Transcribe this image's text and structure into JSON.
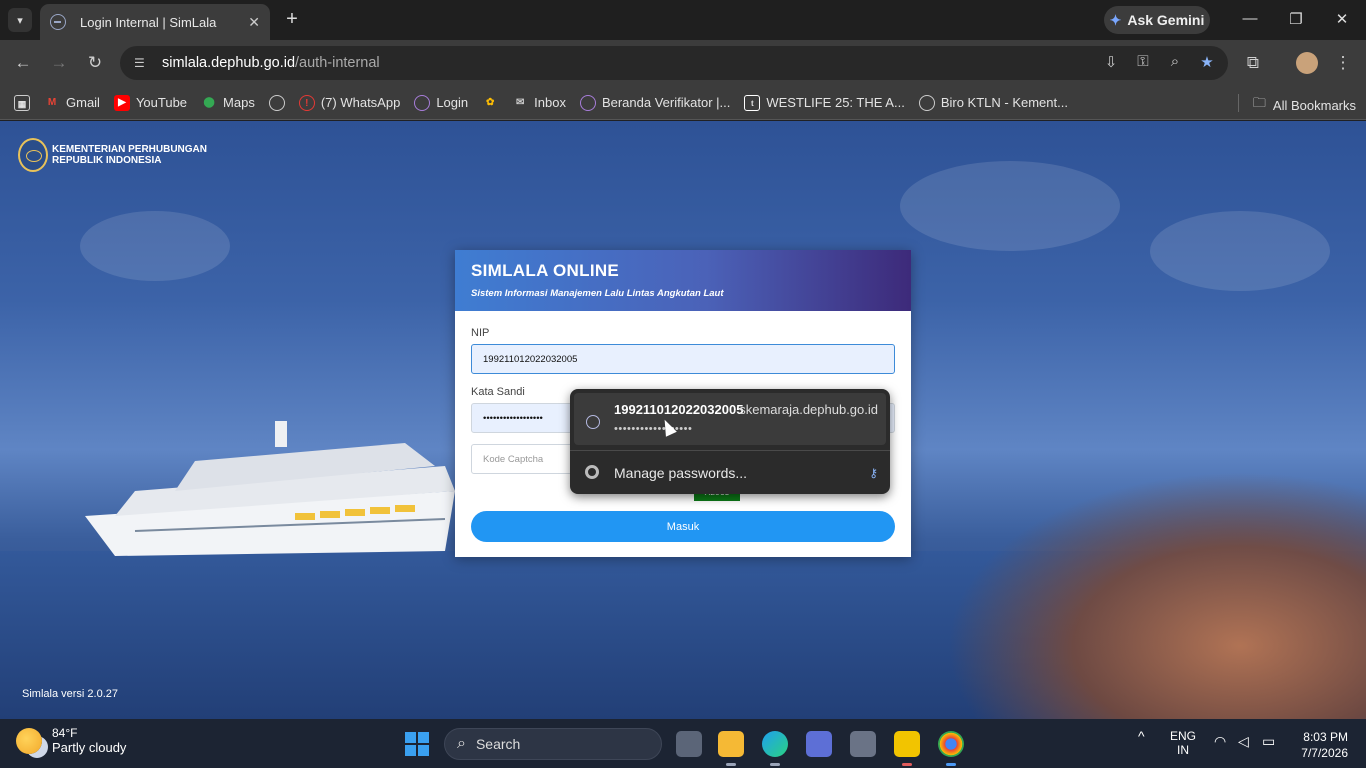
{
  "browser": {
    "tab_title": "Login Internal | SimLala",
    "ask_gemini": "Ask Gemini",
    "url_host": "simlala.dephub.go.id",
    "url_path": "/auth-internal",
    "bookmarks": [
      {
        "label": "Gmail",
        "icon": "gmail-icon",
        "color": "#ea4335"
      },
      {
        "label": "YouTube",
        "icon": "youtube-icon",
        "color": "#ff0000"
      },
      {
        "label": "Maps",
        "icon": "maps-icon",
        "color": "#34a853"
      },
      {
        "label": "",
        "icon": "globe-icon",
        "color": "#cccccc"
      },
      {
        "label": "(7) WhatsApp",
        "icon": "whatsapp-icon",
        "color": "#e53935"
      },
      {
        "label": "Login",
        "icon": "globe-icon",
        "color": "#a77dd9"
      },
      {
        "label": "",
        "icon": "photos-icon",
        "color": "#fbbc04"
      },
      {
        "label": "Inbox",
        "icon": "mail-icon",
        "color": "#cccccc"
      },
      {
        "label": "Beranda Verifikator |...",
        "icon": "globe-icon",
        "color": "#a77dd9"
      },
      {
        "label": "WESTLIFE 25: THE A...",
        "icon": "ticket-icon",
        "color": "#ffffff"
      },
      {
        "label": "Biro KTLN - Kement...",
        "icon": "globe-icon",
        "color": "#cccccc"
      }
    ],
    "all_bookmarks": "All Bookmarks"
  },
  "page": {
    "logo_line1": "KEMENTERIAN PERHUBUNGAN",
    "logo_line2": "REPUBLIK INDONESIA",
    "version": "Simlala versi 2.0.27",
    "card_title": "SIMLALA ONLINE",
    "card_subtitle": "Sistem Informasi Manajemen Lalu Lintas Angkutan Laut",
    "nip_label": "NIP",
    "nip_value": "199211012022032005",
    "password_label": "Kata Sandi",
    "password_value": "••••••••••••••••••",
    "captcha_placeholder": "Kode Captcha",
    "captcha_image_text": "Xz9c5",
    "submit_label": " Masuk"
  },
  "autofill": {
    "username": "199211012022032005",
    "site": "skemaraja.dephub.go.id",
    "password_mask": "••••••••••••••••••",
    "manage": "Manage passwords..."
  },
  "taskbar": {
    "temperature": "84°F",
    "weather": "Partly cloudy",
    "search": "Search",
    "lang1": "ENG",
    "lang2": "IN",
    "time": "8:03 PM",
    "date": "7/7/2026"
  }
}
